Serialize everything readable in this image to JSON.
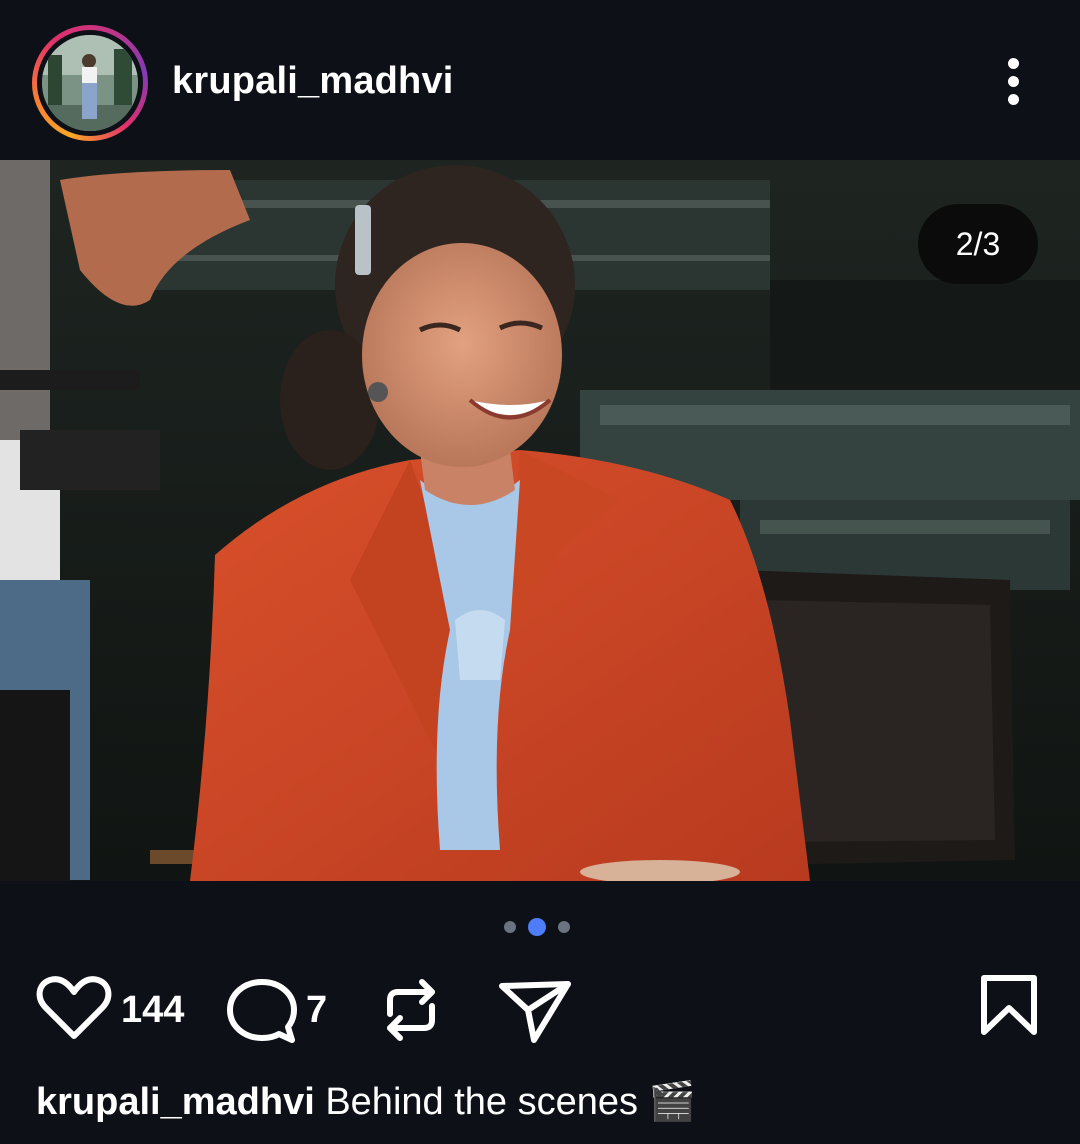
{
  "header": {
    "username": "krupali_madhvi"
  },
  "media": {
    "counter": "2/3",
    "photo_description_icon": "photo",
    "current_index": 2,
    "total": 3
  },
  "actions": {
    "like_icon": "heart-icon",
    "like_count": "144",
    "comment_icon": "comment-icon",
    "comment_count": "7",
    "repost_icon": "repost-icon",
    "share_icon": "send-icon",
    "save_icon": "bookmark-icon"
  },
  "caption": {
    "username": "krupali_madhvi",
    "text": "Behind the scenes 🎬"
  },
  "colors": {
    "background": "#0d1117",
    "active_dot": "#4f7df9",
    "inactive_dot": "#6b7280"
  }
}
